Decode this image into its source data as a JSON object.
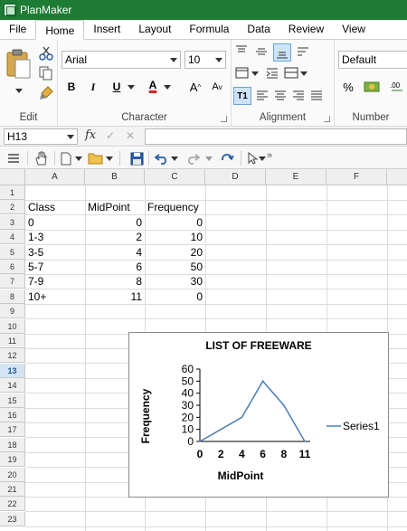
{
  "app": {
    "title": "PlanMaker"
  },
  "menu": {
    "items": [
      "File",
      "Home",
      "Insert",
      "Layout",
      "Formula",
      "Data",
      "Review",
      "View"
    ],
    "active": "Home"
  },
  "ribbon": {
    "groups": {
      "edit": "Edit",
      "character": "Character",
      "alignment": "Alignment",
      "number": "Number"
    },
    "font_name": "Arial",
    "font_size": "10",
    "number_format": "Default",
    "bold": "B",
    "italic": "I",
    "underline": "U",
    "font_color_letter": "A",
    "grow_font": "A",
    "shrink_font": "A",
    "percent": "%",
    "merge_label": "T1",
    "colors": {
      "font_color_bar": "#e02020",
      "accent": "#1e7b34"
    }
  },
  "formula_bar": {
    "cell_ref": "H13",
    "fx": "fx",
    "confirm": "✓",
    "cancel": "✕",
    "content": ""
  },
  "sheet": {
    "columns": [
      "A",
      "B",
      "C",
      "D",
      "E",
      "F"
    ],
    "rows": [
      "1",
      "2",
      "3",
      "4",
      "5",
      "6",
      "7",
      "8",
      "9",
      "10",
      "11",
      "12",
      "13",
      "14",
      "15",
      "16",
      "17",
      "18",
      "19",
      "20",
      "21",
      "22",
      "23"
    ],
    "active_row": "13",
    "headers": [
      "Class",
      "MidPoint",
      "Frequency"
    ],
    "data": [
      [
        "0",
        "0",
        "0"
      ],
      [
        "1-3",
        "2",
        "10"
      ],
      [
        "3-5",
        "4",
        "20"
      ],
      [
        "5-7",
        "6",
        "50"
      ],
      [
        "7-9",
        "8",
        "30"
      ],
      [
        "10+",
        "11",
        "0"
      ]
    ]
  },
  "chart_data": {
    "type": "line",
    "title": "LIST OF FREEWARE",
    "xlabel": "MidPoint",
    "ylabel": "Frequency",
    "categories": [
      "0",
      "2",
      "4",
      "6",
      "8",
      "11"
    ],
    "series": [
      {
        "name": "Series1",
        "values": [
          0,
          10,
          20,
          50,
          30,
          0
        ],
        "color": "#4a7ebb"
      }
    ],
    "ylim": [
      0,
      60
    ],
    "yticks": [
      "0",
      "10",
      "20",
      "30",
      "40",
      "50",
      "60"
    ],
    "grid": false,
    "legend": "right"
  }
}
